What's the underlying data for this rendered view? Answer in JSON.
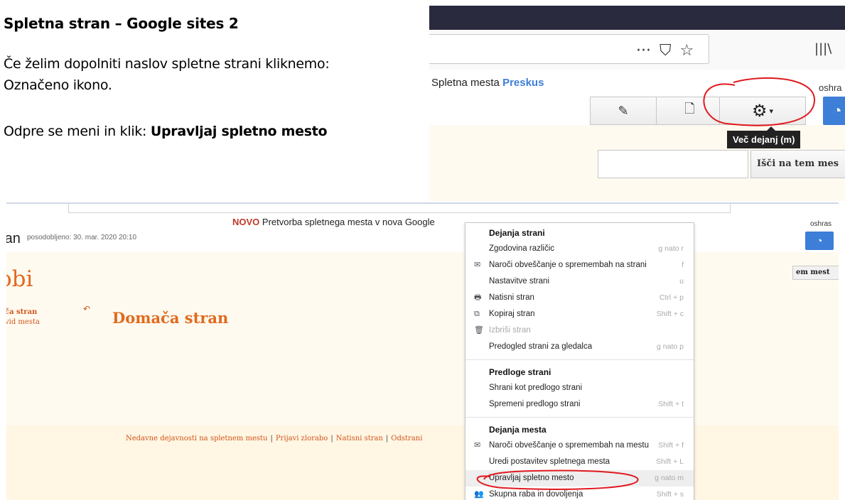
{
  "doc": {
    "title": "Spletna stran – Google sites 2",
    "para1": "Če želim dopolniti naslov spletne strani kliknemo: Označeno ikono.",
    "para2_prefix": "Odpre se meni in klik: ",
    "para2_bold": "Upravljaj spletno mesto"
  },
  "shot_top": {
    "toolbar_icons": [
      "···",
      "⛉",
      "☆"
    ],
    "library_icon": "|||\\",
    "site_label": "Spletna mesta",
    "site_brand": "Preskus",
    "user_partial": "oshra",
    "edit_icon": "✎",
    "newpage_icon": "🗋",
    "gear_icon": "⚙",
    "tooltip": "Več dejanj (m)",
    "search_button": "Išči na tem mes",
    "colors": {
      "accent": "#3d7ed8",
      "annotation": "#e0191f"
    }
  },
  "shot_bottom": {
    "notice_new": "NOVO",
    "notice_text": "Pretvorba spletnega mesta v nova Google",
    "site_title_partial": "ran",
    "updated": "posodobljeno: 30. mar. 2020 20:10",
    "user_partial": "oshras",
    "big_title_partial": "obi",
    "nav_item_1": "ča stran",
    "nav_item_2": "vid mesta",
    "page_title": "Domača stran",
    "search_button_partial": "em mest",
    "footer_links": [
      "Nedavne dejavnosti na spletnem mestu",
      "Prijavi zlorabo",
      "Natisni stran",
      "Odstrani"
    ],
    "menu": {
      "sections": [
        {
          "heading": "Dejanja strani",
          "items": [
            {
              "label": "Zgodovina različic",
              "shortcut": "g nato r",
              "icon": ""
            },
            {
              "label": "Naroči obveščanje o spremembah na strani",
              "shortcut": "f",
              "icon": "✉"
            },
            {
              "label": "Nastavitve strani",
              "shortcut": "u",
              "icon": ""
            },
            {
              "label": "Natisni stran",
              "shortcut": "Ctrl + p",
              "icon": "🖶"
            },
            {
              "label": "Kopiraj stran",
              "shortcut": "Shift + c",
              "icon": "⧉"
            },
            {
              "label": "Izbriši stran",
              "shortcut": "",
              "icon": "🗑"
            },
            {
              "label": "Predogled strani za gledalca",
              "shortcut": "g nato p",
              "icon": ""
            }
          ]
        },
        {
          "heading": "Predloge strani",
          "items": [
            {
              "label": "Shrani kot predlogo strani",
              "shortcut": "",
              "icon": ""
            },
            {
              "label": "Spremeni predlogo strani",
              "shortcut": "Shift + t",
              "icon": ""
            }
          ]
        },
        {
          "heading": "Dejanja mesta",
          "items": [
            {
              "label": "Naroči obveščanje o spremembah na mestu",
              "shortcut": "Shift + f",
              "icon": "✉"
            },
            {
              "label": "Uredi postavitev spletnega mesta",
              "shortcut": "Shift + L",
              "icon": ""
            },
            {
              "label": "Upravljaj spletno mesto",
              "shortcut": "g nato m",
              "icon": ""
            },
            {
              "label": "Skupna raba in dovoljenja",
              "shortcut": "Shift + s",
              "icon": "👥"
            }
          ]
        }
      ]
    }
  }
}
